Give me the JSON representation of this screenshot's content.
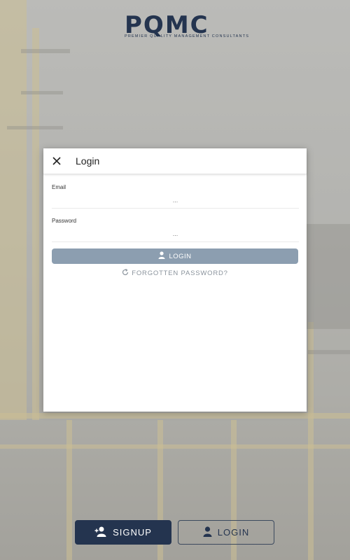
{
  "logo": {
    "text": "PQMC",
    "subtitle": "PREMIER QUALITY MANAGEMENT CONSULTANTS"
  },
  "dialog": {
    "title": "Login",
    "email": {
      "label": "Email",
      "value": "..."
    },
    "password": {
      "label": "Password",
      "value": "..."
    },
    "submit_label": "LOGIN",
    "forgot_label": "FORGOTTEN PASSWORD?"
  },
  "bottom": {
    "signup_label": "SIGNUP",
    "login_label": "LOGIN"
  },
  "icons": {
    "close": "close-icon",
    "user": "user-icon",
    "add_user": "add-user-icon",
    "refresh": "refresh-icon"
  },
  "colors": {
    "brand_navy": "#24344f",
    "button_disabled": "#8c9eb0",
    "muted_text": "#8a939c"
  }
}
